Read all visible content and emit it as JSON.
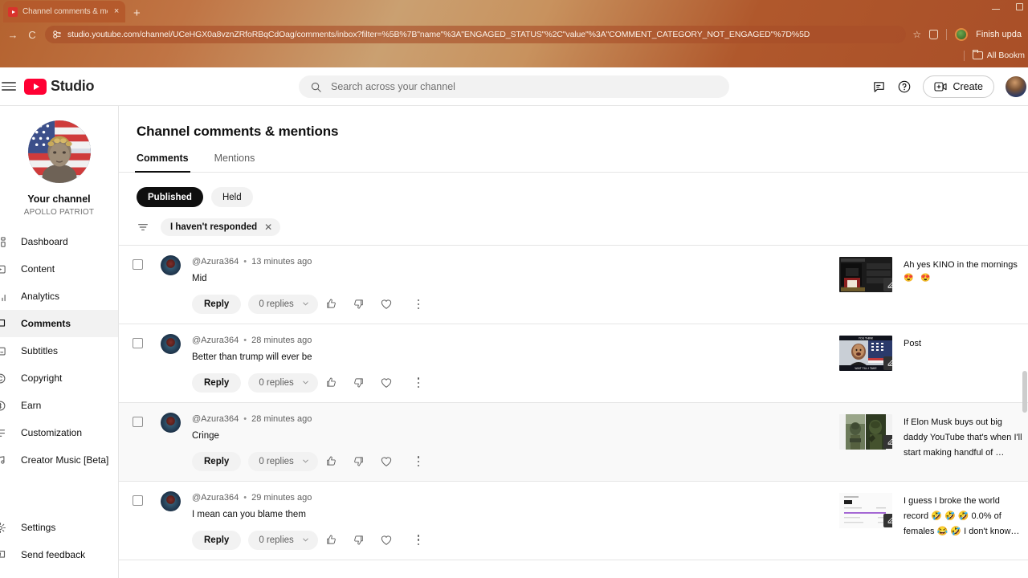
{
  "browser": {
    "tab": {
      "title": "Channel comments & mention",
      "close_label": "×",
      "favicon": "youtube-favicon"
    },
    "new_tab_label": "+",
    "window_controls": {
      "minimize": "minimize",
      "maximize": "maximize"
    },
    "nav": {
      "forward": "→",
      "reload": "C"
    },
    "url": "studio.youtube.com/channel/UCeHGX0a8vznZRfoRBqCdOag/comments/inbox?filter=%5B%7B\"name\"%3A\"ENGAGED_STATUS\"%2C\"value\"%3A\"COMMENT_CATEGORY_NOT_ENGAGED\"%7D%5D",
    "bookmark_star": "☆",
    "finish_update_label": "Finish upda",
    "bookmarks_label": "All Bookm"
  },
  "header": {
    "brand": "Studio",
    "search_placeholder": "Search across your channel",
    "create_label": "Create",
    "icons": {
      "feedback": "feedback-icon",
      "help": "help-icon"
    }
  },
  "sidebar": {
    "channel_label": "Your channel",
    "channel_handle": "APOLLO PATRIOT",
    "items": [
      {
        "label": "Dashboard",
        "icon": "dashboard-icon",
        "key": "dashboard",
        "active": false
      },
      {
        "label": "Content",
        "icon": "content-icon",
        "key": "content",
        "active": false
      },
      {
        "label": "Analytics",
        "icon": "analytics-icon",
        "key": "analytics",
        "active": false
      },
      {
        "label": "Comments",
        "icon": "comments-icon",
        "key": "comments",
        "active": true
      },
      {
        "label": "Subtitles",
        "icon": "subtitles-icon",
        "key": "subtitles",
        "active": false
      },
      {
        "label": "Copyright",
        "icon": "copyright-icon",
        "key": "copyright",
        "active": false
      },
      {
        "label": "Earn",
        "icon": "earn-icon",
        "key": "earn",
        "active": false
      },
      {
        "label": "Customization",
        "icon": "customization-icon",
        "key": "customization",
        "active": false
      },
      {
        "label": "Creator Music [Beta]",
        "icon": "music-icon",
        "key": "creator-music",
        "active": false
      }
    ],
    "bottom_items": [
      {
        "label": "Settings",
        "icon": "gear-icon",
        "key": "settings"
      },
      {
        "label": "Send feedback",
        "icon": "feedback-icon",
        "key": "send-feedback"
      }
    ]
  },
  "main": {
    "page_title": "Channel comments & mentions",
    "tabs": [
      {
        "label": "Comments",
        "active": true
      },
      {
        "label": "Mentions",
        "active": false
      }
    ],
    "chips": [
      {
        "label": "Published",
        "selected": true
      },
      {
        "label": "Held",
        "selected": false
      }
    ],
    "filter": {
      "icon": "filter-icon",
      "chip_label": "I haven't responded",
      "chip_remove": "✕"
    },
    "actions": {
      "reply": "Reply",
      "replies_count": "0 replies",
      "chevron": "chevron-down-icon",
      "like": "thumbs-up-icon",
      "dislike": "thumbs-down-icon",
      "heart": "heart-icon",
      "more": "more-vertical-icon"
    },
    "comments": [
      {
        "author": "@Azura364",
        "separator": "•",
        "time": "13 minutes ago",
        "text": "Mid",
        "video_title": "Ah yes KINO in the mornings",
        "video_emoji": "😍 😍",
        "thumb_style": "dark-ui",
        "hovered": false
      },
      {
        "author": "@Azura364",
        "separator": "•",
        "time": "28 minutes ago",
        "text": "Better than trump will ever be",
        "video_title": "Post",
        "video_emoji": "",
        "thumb_style": "meme-person",
        "hovered": false
      },
      {
        "author": "@Azura364",
        "separator": "•",
        "time": "28 minutes ago",
        "text": "Cringe",
        "video_title": "If Elon Musk buys out big daddy YouTube that's when I'll start making handful of …",
        "video_emoji": "",
        "thumb_style": "soldier-split",
        "hovered": true
      },
      {
        "author": "@Azura364",
        "separator": "•",
        "time": "29 minutes ago",
        "text": "I mean can you blame them",
        "video_title": "I guess I broke the world record 🤣 🤣 🤣 0.0% of females 😂 🤣 I don't know…",
        "video_emoji": "",
        "thumb_style": "light-chart",
        "hovered": false
      }
    ]
  },
  "colors": {
    "accent_red": "#ff0033",
    "chip_selected_bg": "#0f0f0f",
    "row_hover": "#f9f9f9",
    "browser_chrome": "#b4622f"
  }
}
